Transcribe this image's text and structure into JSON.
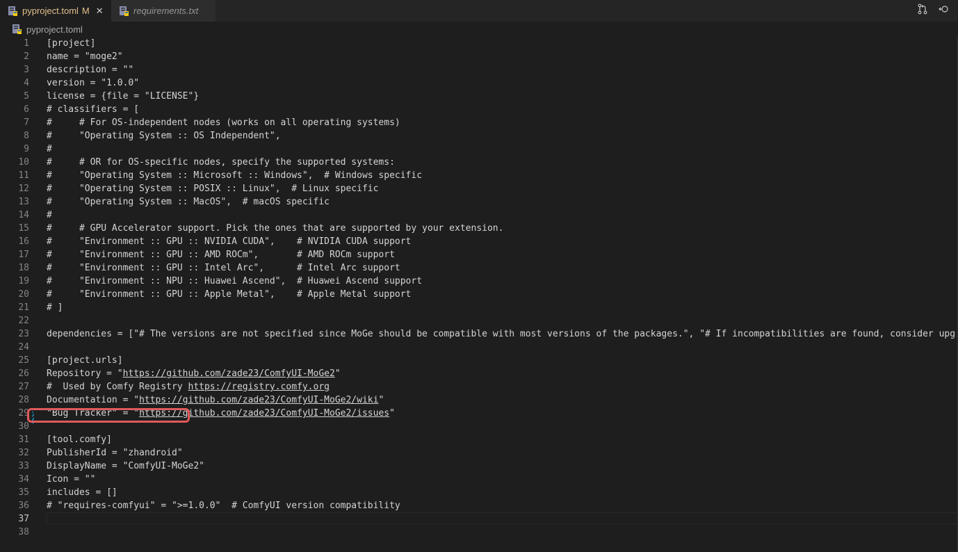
{
  "tabs": [
    {
      "label": "pyproject.toml",
      "status": "M",
      "icon": "toml-file-icon",
      "active": true
    },
    {
      "label": "requirements.txt",
      "icon": "text-file-icon",
      "active": false
    }
  ],
  "toolbar": {
    "compare_icon": "compare-changes-icon",
    "more_icon": "open-changes-icon"
  },
  "breadcrumb": {
    "file": "pyproject.toml"
  },
  "editor": {
    "current_line": 37,
    "lines": [
      "[project]",
      "name = \"moge2\"",
      "description = \"\"",
      "version = \"1.0.0\"",
      "license = {file = \"LICENSE\"}",
      "# classifiers = [",
      "#     # For OS-independent nodes (works on all operating systems)",
      "#     \"Operating System :: OS Independent\",",
      "#",
      "#     # OR for OS-specific nodes, specify the supported systems:",
      "#     \"Operating System :: Microsoft :: Windows\",  # Windows specific",
      "#     \"Operating System :: POSIX :: Linux\",  # Linux specific",
      "#     \"Operating System :: MacOS\",  # macOS specific",
      "#",
      "#     # GPU Accelerator support. Pick the ones that are supported by your extension.",
      "#     \"Environment :: GPU :: NVIDIA CUDA\",    # NVIDIA CUDA support",
      "#     \"Environment :: GPU :: AMD ROCm\",       # AMD ROCm support",
      "#     \"Environment :: GPU :: Intel Arc\",      # Intel Arc support",
      "#     \"Environment :: NPU :: Huawei Ascend\",  # Huawei Ascend support",
      "#     \"Environment :: GPU :: Apple Metal\",    # Apple Metal support",
      "# ]",
      "",
      "dependencies = [\"# The versions are not specified since MoGe should be compatible with most versions of the packages.\", \"# If incompatibilities are found, consider upgradi",
      "",
      "[project.urls]",
      "Repository = \"https://github.com/zade23/ComfyUI-MoGe2\"",
      "#  Used by Comfy Registry https://registry.comfy.org",
      "Documentation = \"https://github.com/zade23/ComfyUI-MoGe2/wiki\"",
      "\"Bug Tracker\" = \"https://github.com/zade23/ComfyUI-MoGe2/issues\"",
      "",
      "[tool.comfy]",
      "PublisherId = \"zhandroid\"",
      "DisplayName = \"ComfyUI-MoGe2\"",
      "Icon = \"\"",
      "includes = []",
      "# \"requires-comfyui\" = \">=1.0.0\"  # ComfyUI version compatibility",
      "",
      ""
    ]
  }
}
